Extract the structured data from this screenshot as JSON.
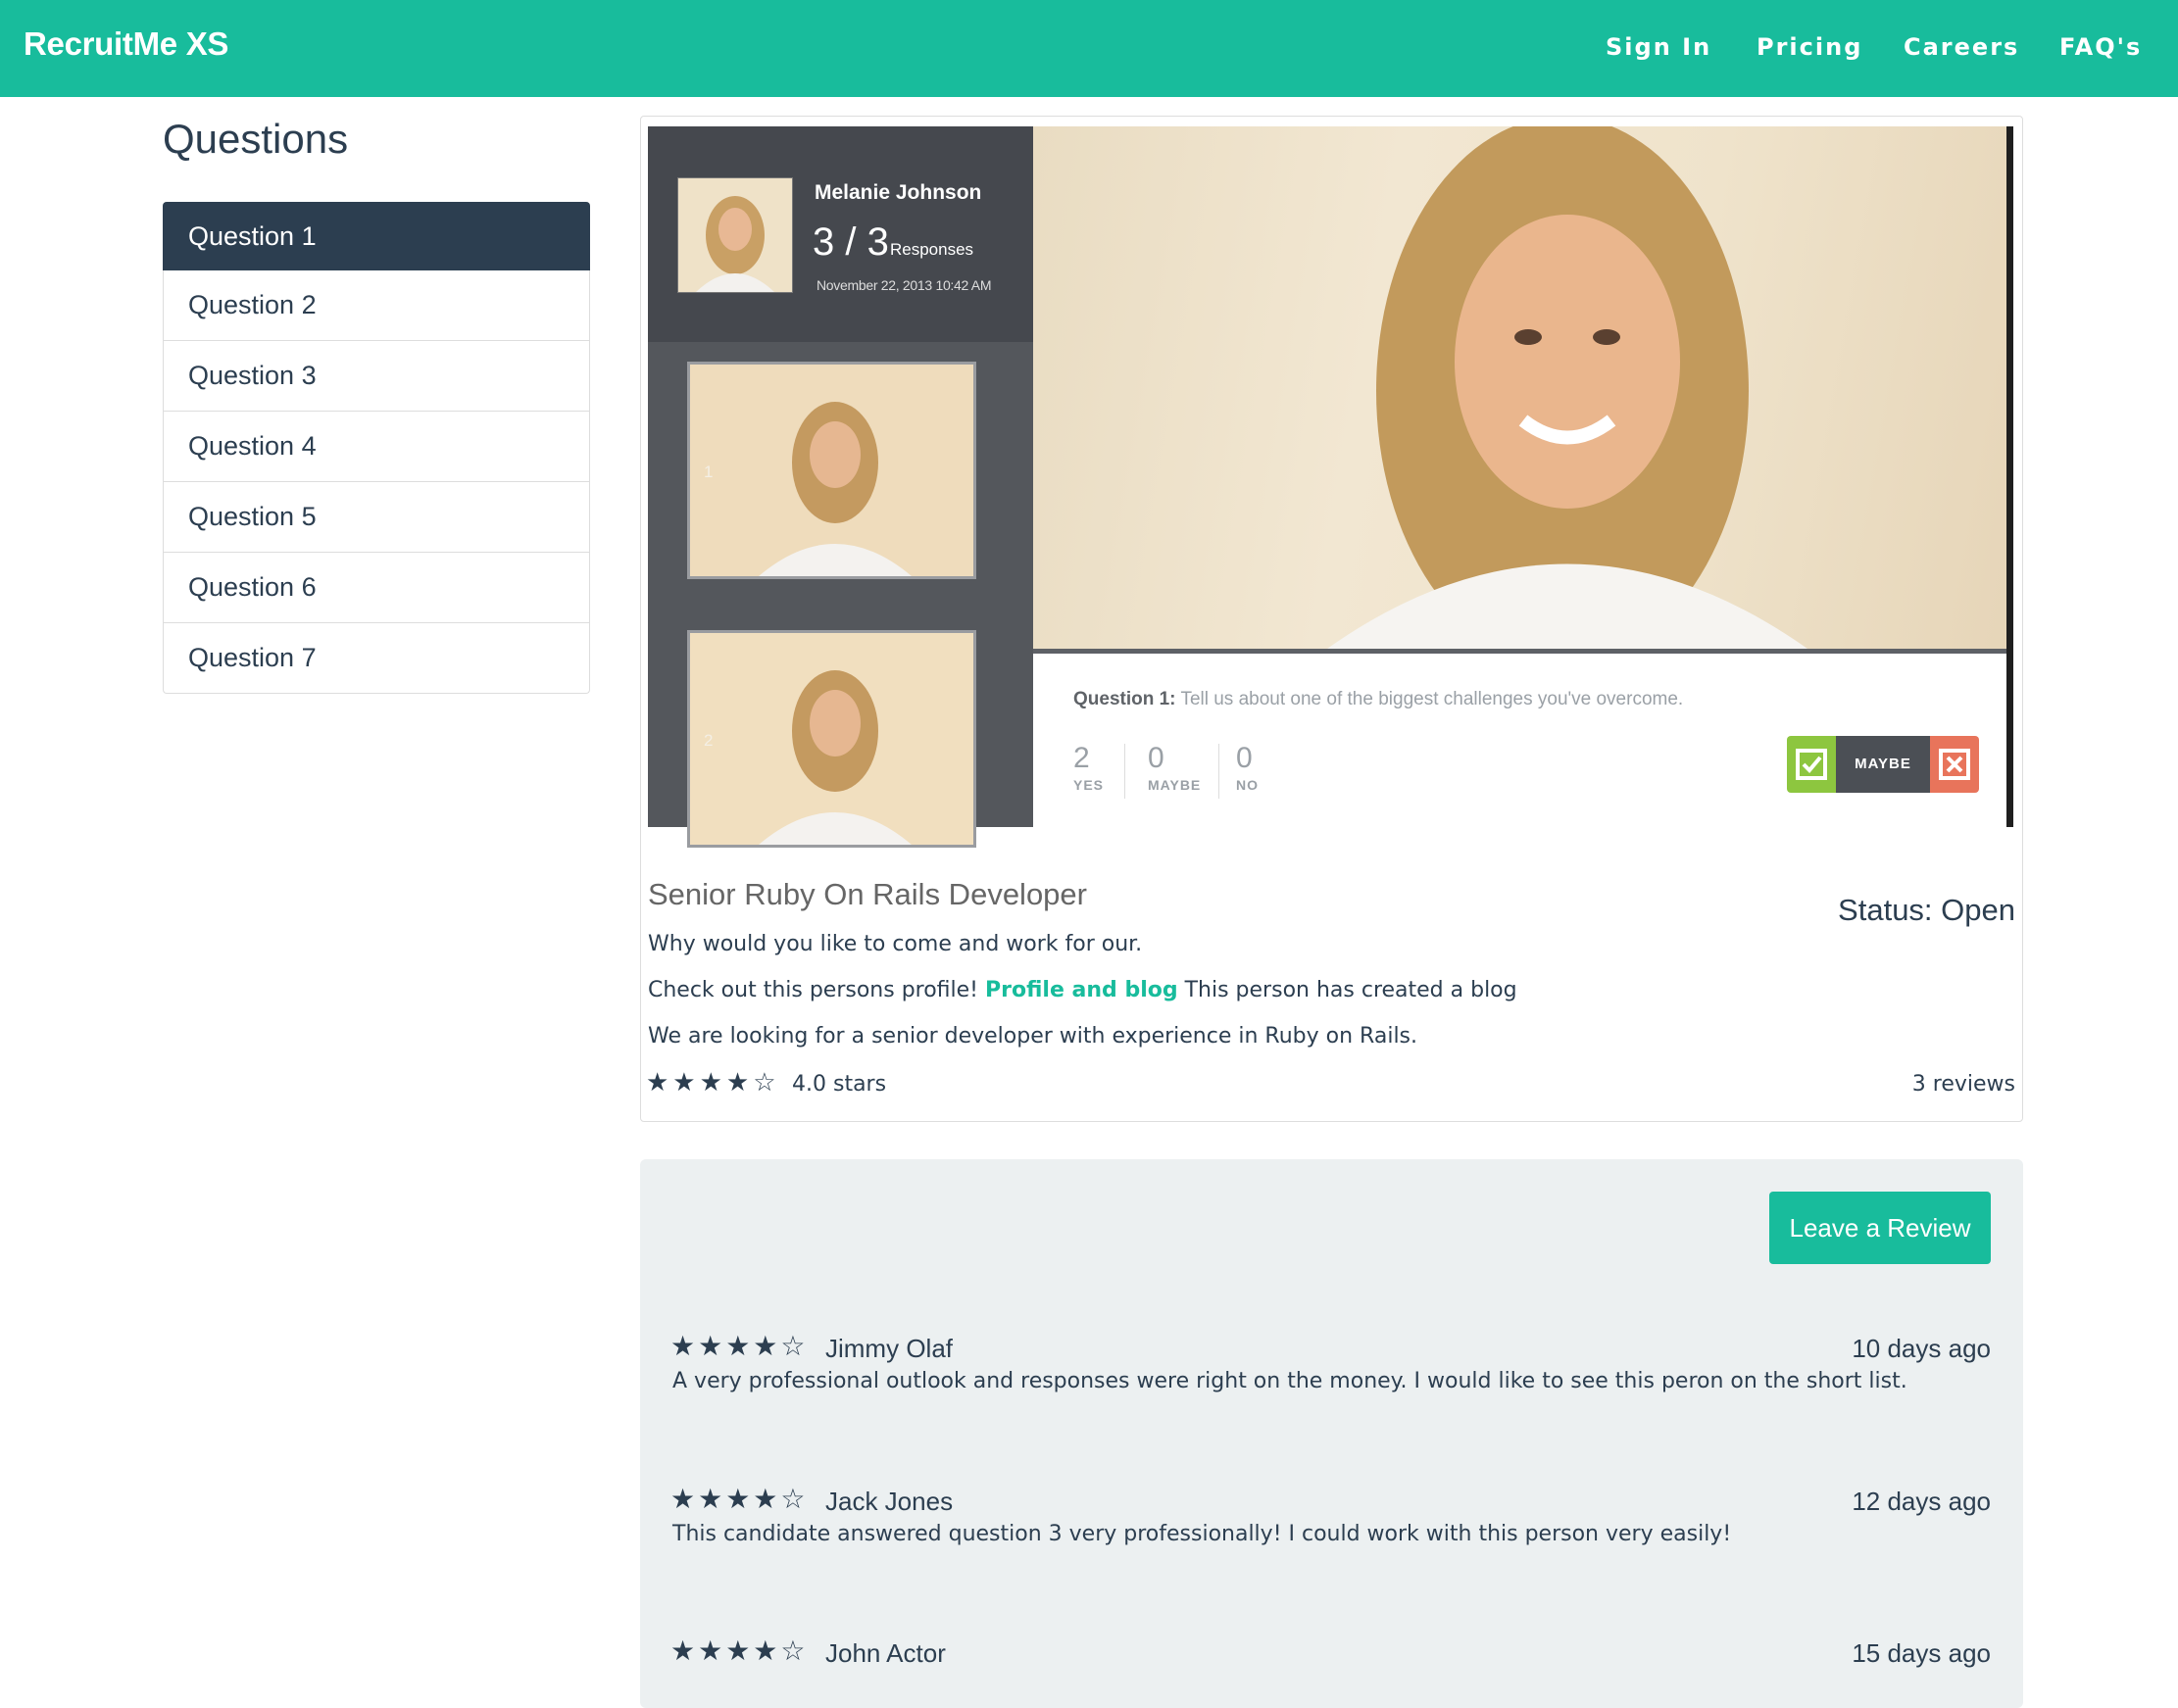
{
  "navbar": {
    "brand": "RecruitMe XS",
    "links": [
      "Sign In",
      "Pricing",
      "Careers",
      "FAQ's"
    ]
  },
  "sidebar": {
    "title": "Questions",
    "items": [
      "Question 1",
      "Question 2",
      "Question 3",
      "Question 4",
      "Question 5",
      "Question 6",
      "Question 7"
    ],
    "active_index": 0
  },
  "video_panel": {
    "candidate_name": "Melanie Johnson",
    "responses": "3 / 3",
    "responses_label": "Responses",
    "date": "November 22, 2013 10:42 AM",
    "thumbnails": [
      "1",
      "2"
    ],
    "question_label": "Question 1:",
    "question_text": "Tell us about one of the biggest challenges you've overcome.",
    "votes": [
      {
        "count": "2",
        "label": "YES"
      },
      {
        "count": "0",
        "label": "MAYBE"
      },
      {
        "count": "0",
        "label": "NO"
      }
    ],
    "vote_button_label": "MAYBE",
    "colors": {
      "yes": "#8dc63f",
      "maybe": "#4b4f55",
      "no": "#e8745b"
    }
  },
  "job": {
    "title": "Senior Ruby On Rails Developer",
    "status": "Status: Open",
    "line1": "Why would you like to come and work for our.",
    "line2_prefix": "Check out this persons profile!",
    "line2_link": "Profile and blog",
    "line2_suffix": "This person has created a blog",
    "line3": "We are looking for a senior developer with experience in Ruby on Rails.",
    "stars": "★★★★☆",
    "rating_value": 4.0,
    "rating_text": "4.0 stars",
    "reviews_count": "3 reviews"
  },
  "reviews": {
    "button_label": "Leave a Review",
    "items": [
      {
        "stars": "★★★★☆",
        "name": "Jimmy Olaf",
        "time": "10 days ago",
        "text": "A very professional outlook and responses were right on the money. I would like to see this peron on the short list."
      },
      {
        "stars": "★★★★☆",
        "name": "Jack Jones",
        "time": "12 days ago",
        "text": "This candidate answered question 3 very professionally! I could work with this person very easily!"
      },
      {
        "stars": "★★★★☆",
        "name": "John Actor",
        "time": "15 days ago",
        "text": ""
      }
    ]
  },
  "colors": {
    "brand": "#18bc9c",
    "primary": "#2c3e50",
    "panel": "#ecf0f1"
  }
}
